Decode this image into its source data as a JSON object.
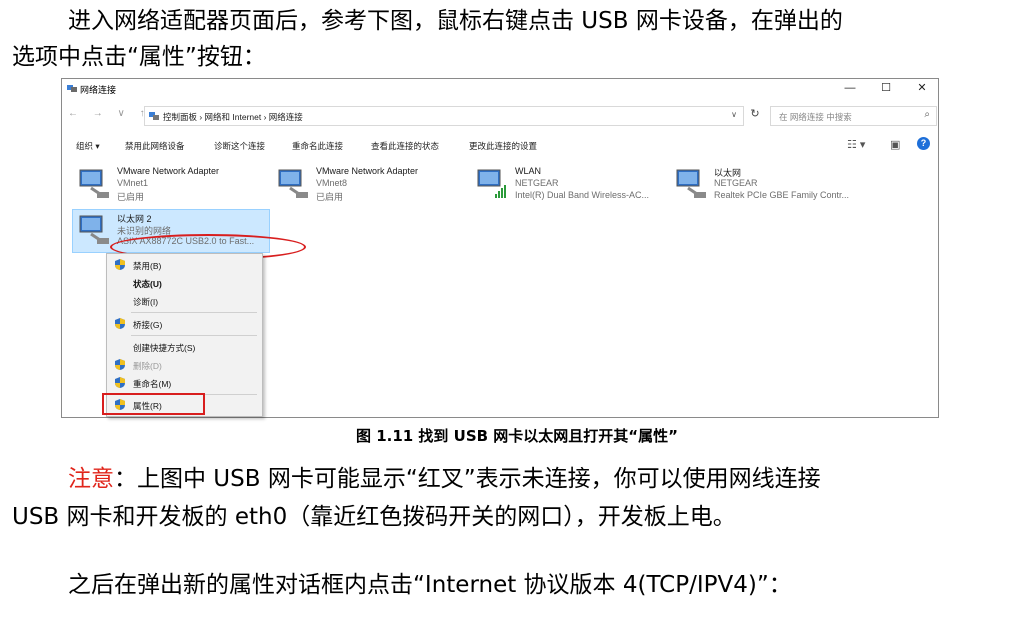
{
  "intro": {
    "line1": "进入网络适配器页面后，参考下图，鼠标右键点击 USB 网卡设备，在弹出的",
    "line2": "选项中点击“属性”按钮："
  },
  "window": {
    "title": "网络连接",
    "controls": {
      "minimize": "—",
      "maximize": "☐",
      "close": "✕"
    },
    "nav": "←  →  ∨  ↑",
    "breadcrumb": "控制面板  ›  网络和 Internet  ›  网络连接",
    "search_placeholder": "在 网络连接 中搜索",
    "commands": [
      "组织 ▾",
      "禁用此网络设备",
      "诊断这个连接",
      "重命名此连接",
      "查看此连接的状态",
      "更改此连接的设置"
    ],
    "adapters": [
      {
        "name": "VMware Network Adapter",
        "line2": "VMnet1",
        "line3": "已启用"
      },
      {
        "name": "VMware Network Adapter",
        "line2": "VMnet8",
        "line3": "已启用"
      },
      {
        "name": "WLAN",
        "line2": "NETGEAR",
        "line3": "Intel(R) Dual Band Wireless-AC..."
      },
      {
        "name": "以太网",
        "line2": "NETGEAR",
        "line3": "Realtek PCIe GBE Family Contr..."
      },
      {
        "name": "以太网 2",
        "line2": "未识别的网络",
        "line3": "ASIX AX88772C USB2.0 to Fast..."
      }
    ],
    "context_menu": [
      {
        "label": "禁用(B)",
        "shield": true
      },
      {
        "label": "状态(U)",
        "bold": true
      },
      {
        "label": "诊断(I)"
      },
      {
        "label": "桥接(G)",
        "shield": true
      },
      {
        "label": "创建快捷方式(S)"
      },
      {
        "label": "删除(D)",
        "shield": true,
        "disabled": true
      },
      {
        "label": "重命名(M)",
        "shield": true
      },
      {
        "label": "属性(R)",
        "shield": true
      }
    ]
  },
  "caption": "图 1.11 找到 USB 网卡以太网且打开其“属性”",
  "note": {
    "label": "注意",
    "line1_rest": "：上图中 USB 网卡可能显示“红叉”表示未连接，你可以使用网线连接",
    "line2": "USB 网卡和开发板的 eth0（靠近红色拨码开关的网口），开发板上电。"
  },
  "after": "之后在弹出新的属性对话框内点击“Internet 协议版本 4(TCP/IPV4)”：",
  "colors": {
    "accent_red": "#e0251b",
    "selection": "#cce8ff",
    "help_blue": "#1e6fd9"
  }
}
